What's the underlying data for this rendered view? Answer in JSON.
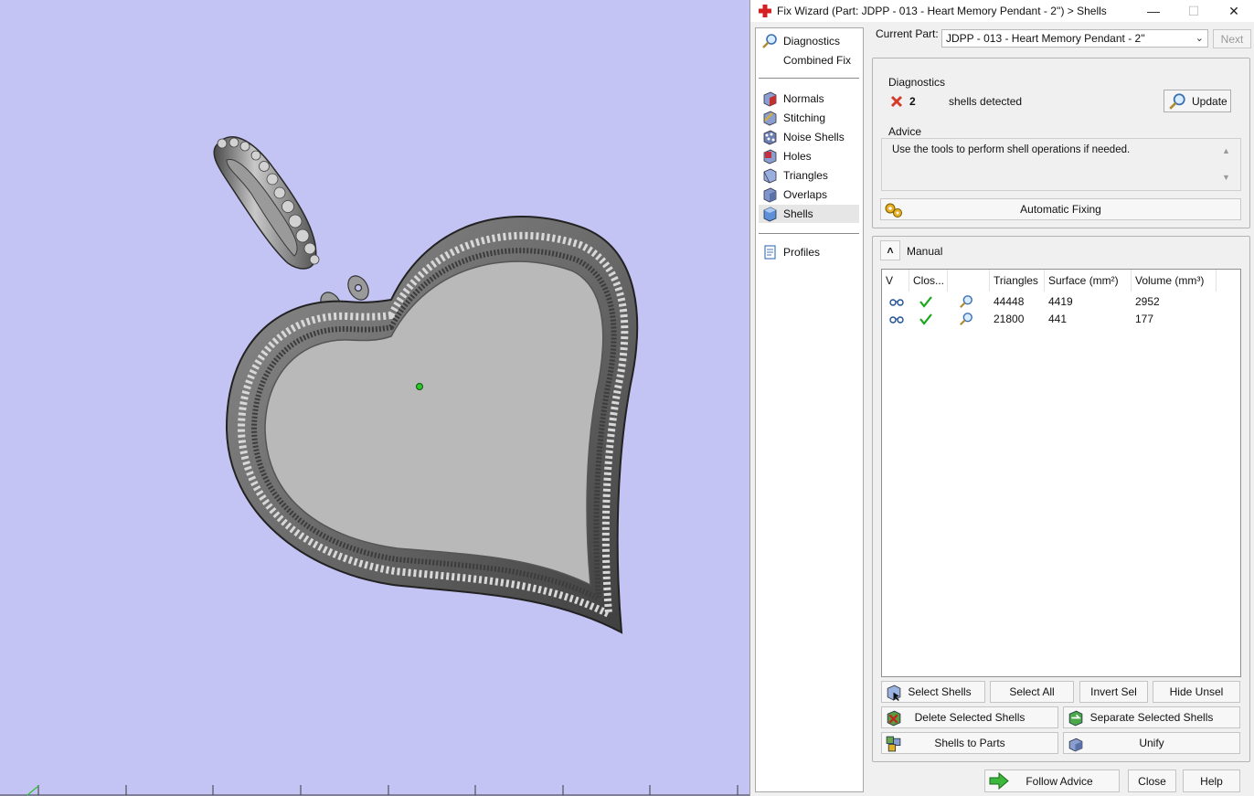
{
  "window": {
    "title": "Fix Wizard (Part: JDPP - 013 - Heart Memory Pendant - 2'') > Shells",
    "controls": {
      "minimize": "—",
      "maximize": "☐",
      "close": "✕"
    }
  },
  "nav": {
    "items": [
      {
        "label": "Diagnostics",
        "icon": "magnifier-icon"
      },
      {
        "label": "Combined Fix",
        "icon": ""
      },
      {
        "label": "Normals",
        "icon": "normals-cube-icon"
      },
      {
        "label": "Stitching",
        "icon": "stitching-cube-icon"
      },
      {
        "label": "Noise Shells",
        "icon": "noise-shells-cube-icon"
      },
      {
        "label": "Holes",
        "icon": "holes-cube-icon"
      },
      {
        "label": "Triangles",
        "icon": "triangles-cube-icon"
      },
      {
        "label": "Overlaps",
        "icon": "overlaps-cube-icon"
      },
      {
        "label": "Shells",
        "icon": "shells-cube-icon",
        "selected": true
      },
      {
        "label": "Profiles",
        "icon": "document-icon"
      }
    ]
  },
  "current_part": {
    "label": "Current Part:",
    "value": "JDPP - 013 - Heart Memory Pendant - 2''",
    "next_label": "Next"
  },
  "diagnostics": {
    "group_label": "Diagnostics",
    "count": "2",
    "text": "shells detected",
    "update_label": "Update",
    "status_color": "#d43b2a"
  },
  "advice": {
    "group_label": "Advice",
    "text": "Use the tools to perform shell operations if needed."
  },
  "automatic_fixing_label": "Automatic Fixing",
  "manual": {
    "label": "Manual",
    "collapse_glyph": "˄",
    "table": {
      "columns": [
        "V",
        "Clos...",
        "",
        "Triangles",
        "Surface (mm²)",
        "Volume (mm³)"
      ],
      "rows": [
        {
          "triangles": "44448",
          "surface": "4419",
          "volume": "2952",
          "closed": true
        },
        {
          "triangles": "21800",
          "surface": "441",
          "volume": "177",
          "closed": true
        }
      ]
    },
    "buttons": {
      "select_shells": "Select Shells",
      "select_all": "Select All",
      "invert_sel": "Invert Sel",
      "hide_unsel": "Hide Unsel",
      "delete_selected": "Delete Selected Shells",
      "separate_selected": "Separate Selected Shells",
      "shells_to_parts": "Shells to Parts",
      "unify": "Unify"
    }
  },
  "footer": {
    "follow_advice": "Follow Advice",
    "close": "Close",
    "help": "Help"
  },
  "colors": {
    "viewport_bg": "#c4c4f4",
    "dialog_bg": "#f0f0f0",
    "check_green": "#1aa71a",
    "accent_blue": "#5b8fd6"
  }
}
